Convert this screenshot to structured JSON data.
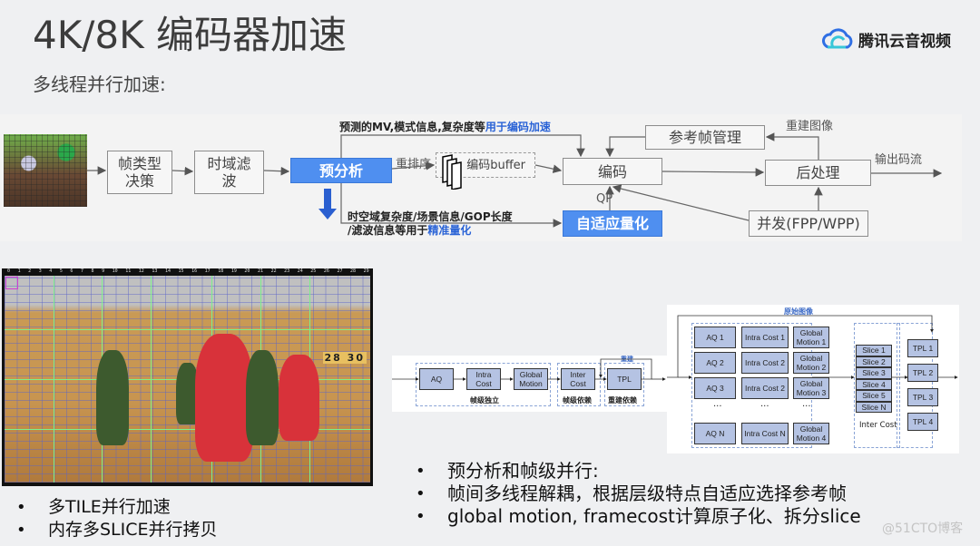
{
  "header": {
    "title": "4K/8K 编码器加速",
    "subtitle": "多线程并行加速:",
    "brand": {
      "name": "腾讯云音视频",
      "icon": "cloud-logo-icon",
      "colors": [
        "#2f6fe4",
        "#37c6d8"
      ]
    }
  },
  "top_diagram": {
    "boxes": {
      "frame_type": "帧类型\n决策",
      "temporal_filter": "时域滤\n波",
      "pre_analysis": "预分析",
      "encode_buffer": "编码buffer",
      "encode": "编码",
      "adaptive_quant": "自适应量化",
      "ref_frame_mgmt": "参考帧管理",
      "post_process": "后处理",
      "parallel": "并发(FPP/WPP)"
    },
    "labels": {
      "top_note_prefix": "预测的MV,模式信息,复杂度等",
      "top_note_highlight": "用于编码加速",
      "reorder": "重排序",
      "bottom_note_line1": "时空域复杂度/场景信息/GOP长度",
      "bottom_note_line2_prefix": "/滤波信息等用于",
      "bottom_note_line2_highlight": "精准量化",
      "qp": "QP",
      "reconstructed": "重建图像",
      "output_stream": "输出码流"
    },
    "accent_color": "#4f8ff0",
    "highlight_color": "#2a63d6"
  },
  "mid_diagram": {
    "boxes": [
      "AQ",
      "Intra Cost",
      "Global Motion",
      "Inter Cost",
      "TPL"
    ],
    "groups": [
      "帧级独立",
      "帧级依赖",
      "重建依赖"
    ],
    "feedback_label": "重建"
  },
  "right_diagram": {
    "top_label": "原始图像",
    "aq": [
      "AQ 1",
      "AQ 2",
      "AQ 3",
      "···",
      "AQ N"
    ],
    "intra": [
      "Intra Cost 1",
      "Intra Cost 2",
      "Intra Cost 2",
      "···",
      "Intra Cost N"
    ],
    "gm": [
      "Global Motion 1",
      "Global Motion 2",
      "Global Motion 3",
      "···",
      "Global Motion 4"
    ],
    "slices": [
      "Slice 1",
      "Slice 2",
      "Slice 3",
      "Slice 4",
      "Slice 5",
      "Slice N"
    ],
    "slice_group_label": "Inter Cost",
    "tpl": [
      "TPL 1",
      "TPL 2",
      "TPL 3",
      "TPL 4"
    ],
    "box_color": "#b5c3e3"
  },
  "basketball": {
    "ruler": [
      "0",
      "1",
      "2",
      "3",
      "4",
      "5",
      "6",
      "7",
      "8",
      "9",
      "10",
      "11",
      "12",
      "13",
      "14",
      "15",
      "16",
      "17",
      "18",
      "19",
      "20",
      "21",
      "22",
      "23",
      "24",
      "25",
      "26",
      "27",
      "28",
      "29"
    ],
    "scoreboard": "28 30"
  },
  "bullets_right": [
    "预分析和帧级并行:",
    "帧间多线程解耦，根据层级特点自适应选择参考帧",
    "global motion, framecost计算原子化、拆分slice"
  ],
  "bullets_left": [
    "多TILE并行加速",
    "内存多SLICE并行拷贝"
  ],
  "watermark": "@51CTO博客"
}
